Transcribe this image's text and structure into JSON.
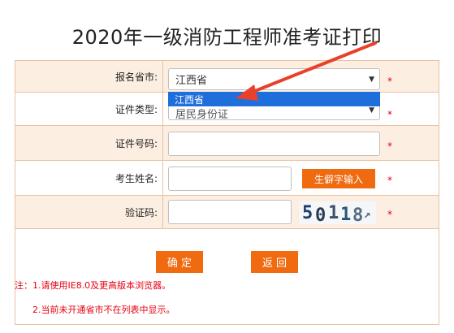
{
  "page": {
    "title": "2020年一级消防工程师准考证打印"
  },
  "form": {
    "province": {
      "label": "报名省市:",
      "value": "江西省",
      "dropdown_option": "江西省"
    },
    "id_type": {
      "label": "证件类型:",
      "value": "居民身份证"
    },
    "id_number": {
      "label": "证件号码:",
      "value": ""
    },
    "name": {
      "label": "考生姓名:",
      "value": "",
      "rare_char_button": "生僻字输入"
    },
    "captcha": {
      "label": "验证码:",
      "value": "",
      "image_text": [
        "5",
        "0",
        "1",
        "1",
        "8",
        "↗"
      ]
    },
    "required_mark": "*"
  },
  "buttons": {
    "confirm": "确 定",
    "back": "返 回"
  },
  "notes": {
    "line1": "注：1.请使用IE8.0及更高版本浏览器。",
    "line2": "2.当前未开通省市不在列表中显示。"
  },
  "colors": {
    "accent": "#f06a10",
    "required": "#e60012",
    "highlight": "#1e6fdc",
    "row_alt": "#fdeee2",
    "arrow": "#e8402a"
  }
}
